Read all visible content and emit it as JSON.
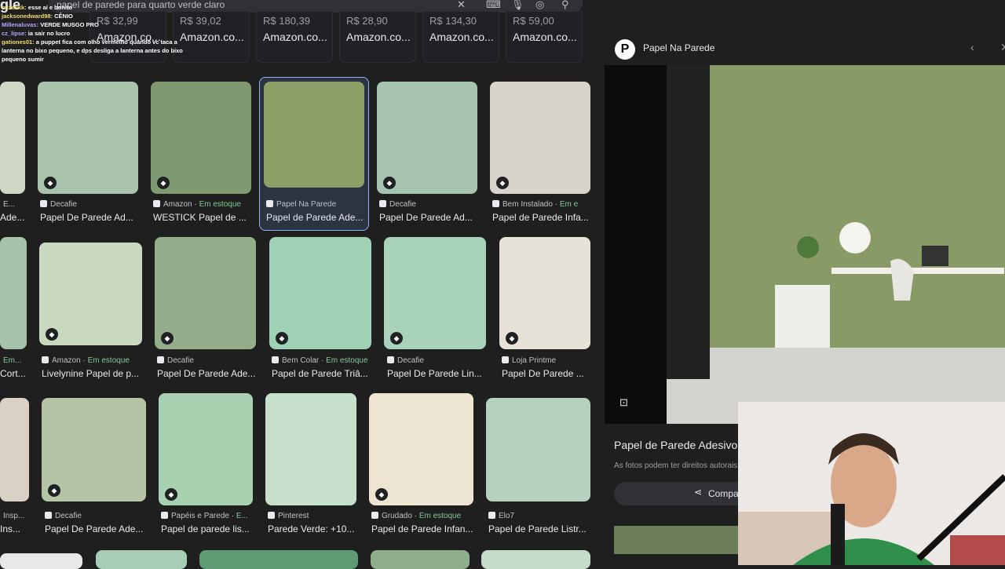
{
  "search": {
    "query": "papel de parede para quarto verde claro"
  },
  "logo": "gle",
  "chat": [
    {
      "user": "mizekkk:",
      "msg": "esse aí e bonito"
    },
    {
      "user": "jacksonedward98:",
      "msg": "CÊNIO"
    },
    {
      "user": "Millenaluvas:",
      "msg": "VERDE MUSGO PRO"
    },
    {
      "user": "cz_lipse:",
      "msg": "ia sair no lucro"
    },
    {
      "user": "gationes01:",
      "msg": "a puppet fica com olho vermelho quando vc taca a lanterna no bixo pequeno, e dps desliga a lanterna antes do bixo pequeno sumir"
    }
  ],
  "chips": [
    {
      "price": "R$ 32,99",
      "site": "Amazon.co..."
    },
    {
      "price": "R$ 39,02",
      "site": "Amazon.co..."
    },
    {
      "price": "R$ 180,39",
      "site": "Amazon.co..."
    },
    {
      "price": "R$ 28,90",
      "site": "Amazon.co..."
    },
    {
      "price": "R$ 134,30",
      "site": "Amazon.co..."
    },
    {
      "price": "R$ 59,00",
      "site": "Amazon.co..."
    }
  ],
  "row1": [
    {
      "source": "E...",
      "stock": "",
      "title": "Ade..."
    },
    {
      "source": "Decafie",
      "stock": "",
      "title": "Papel De Parede Ad..."
    },
    {
      "source": "Amazon",
      "stock": "Em estoque",
      "title": "WESTICK Papel de ..."
    },
    {
      "source": "Papel Na Parede",
      "stock": "",
      "title": "Papel de Parede Ade..."
    },
    {
      "source": "Decafie",
      "stock": "",
      "title": "Papel De Parede Ad..."
    },
    {
      "source": "Bem Instalado",
      "stock": "Em e",
      "title": "Papel de Parede Infa..."
    }
  ],
  "row2": [
    {
      "source": "",
      "stock": "Em...",
      "title": "Cort..."
    },
    {
      "source": "Amazon",
      "stock": "Em estoque",
      "title": "Livelynine Papel de p..."
    },
    {
      "source": "Decafie",
      "stock": "",
      "title": "Papel De Parede Ade..."
    },
    {
      "source": "Bem Colar",
      "stock": "Em estoque",
      "title": "Papel de Parede Triâ..."
    },
    {
      "source": "Decafie",
      "stock": "",
      "title": "Papel De Parede Lin..."
    },
    {
      "source": "Loja Printme",
      "stock": "",
      "title": "Papel De Parede ..."
    }
  ],
  "row3": [
    {
      "source": "Insp...",
      "stock": "",
      "title": "Ins..."
    },
    {
      "source": "Decafie",
      "stock": "",
      "title": "Papel De Parede Ade..."
    },
    {
      "source": "Papéis e Parede",
      "stock": "E...",
      "title": "Papel de parede lis..."
    },
    {
      "source": "Pinterest",
      "stock": "",
      "title": "Parede Verde: +10..."
    },
    {
      "source": "Grudado",
      "stock": "Em estoque",
      "title": "Papel de Parede Infan..."
    },
    {
      "source": "Elo7",
      "stock": "",
      "title": "Papel de Parede Listr..."
    }
  ],
  "panel": {
    "site": "Papel Na Parede",
    "title": "Papel de Parede Adesivo",
    "note": "As fotos podem ter direitos autorais.",
    "share": "Compa"
  },
  "colors": {
    "accent": "#8ab4f8",
    "stock": "#81c995",
    "bg": "#1f1f1f"
  }
}
